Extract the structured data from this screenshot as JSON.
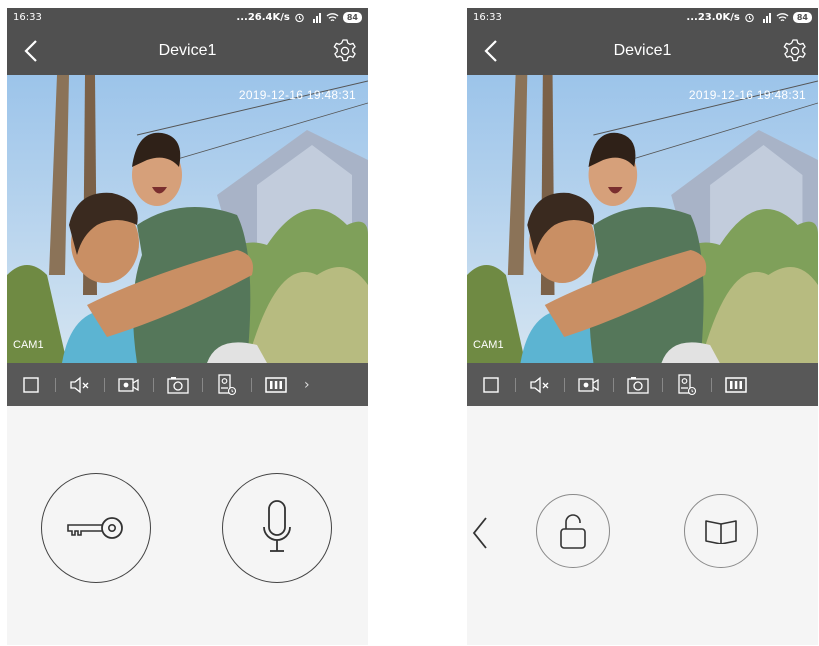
{
  "screens": [
    {
      "status_bar": {
        "time": "16:33",
        "net_speed": "...26.4K/s",
        "battery": "84"
      },
      "header": {
        "title": "Device1"
      },
      "video": {
        "timestamp": "2019-12-16 19:48:31",
        "camera": "CAM1"
      },
      "controls": [
        "unlock-key",
        "microphone"
      ]
    },
    {
      "status_bar": {
        "time": "16:33",
        "net_speed": "...23.0K/s",
        "battery": "84"
      },
      "header": {
        "title": "Device1"
      },
      "video": {
        "timestamp": "2019-12-16 19:48:31",
        "camera": "CAM1"
      },
      "controls": [
        "open-lock",
        "book"
      ]
    }
  ],
  "toolbar_icons": [
    "stop-icon",
    "mute-icon",
    "record-icon",
    "snapshot-icon",
    "playback-icon",
    "quality-icon"
  ],
  "colors": {
    "bar": "#505050",
    "toolbar": "#585858",
    "background": "#f5f5f5"
  }
}
